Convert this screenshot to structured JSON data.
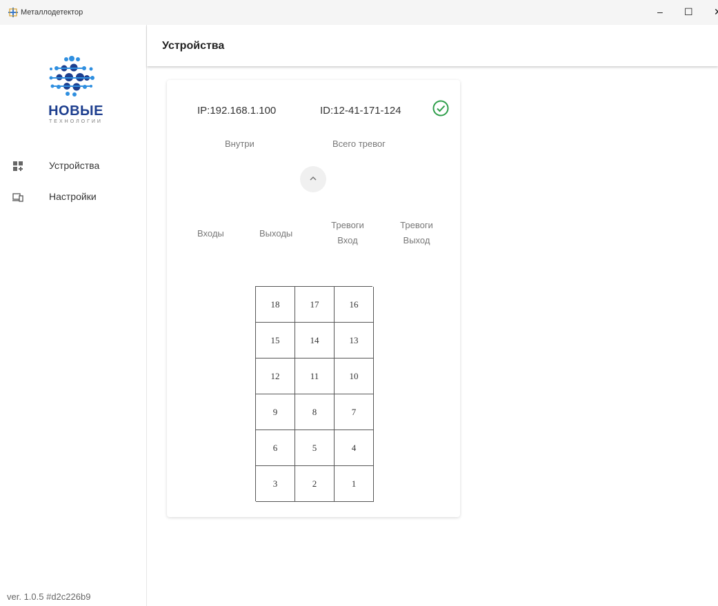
{
  "window": {
    "title": "Металлодетектор",
    "minimize": "–",
    "maximize": "☐",
    "close": "✕"
  },
  "logo": {
    "title": "НОВЫЕ",
    "subtitle": "ТЕХНОЛОГИИ",
    "colors": {
      "dark": "#1d3e8e",
      "light": "#2f8fe0"
    }
  },
  "nav": [
    {
      "label": "Устройства",
      "icon": "devices-grid-icon"
    },
    {
      "label": "Настройки",
      "icon": "settings-monitor-icon"
    }
  ],
  "version": "ver. 1.0.5 #d2c226b9",
  "header": {
    "title": "Устройства"
  },
  "device": {
    "ip": "IP:192.168.1.100",
    "id": "ID:12-41-171-124",
    "status_icon": "check-circle-icon",
    "status_color": "#2e9e4a",
    "inside_label": "Внутри",
    "total_alarms_label": "Всего тревог",
    "collapse_icon": "chevron-up-icon",
    "columns": {
      "inputs": "Входы",
      "outputs": "Выходы",
      "alarms_in_1": "Тревоги",
      "alarms_in_2": "Вход",
      "alarms_out_1": "Тревоги",
      "alarms_out_2": "Выход"
    },
    "zones": [
      "18",
      "17",
      "16",
      "15",
      "14",
      "13",
      "12",
      "11",
      "10",
      "9",
      "8",
      "7",
      "6",
      "5",
      "4",
      "3",
      "2",
      "1"
    ]
  }
}
